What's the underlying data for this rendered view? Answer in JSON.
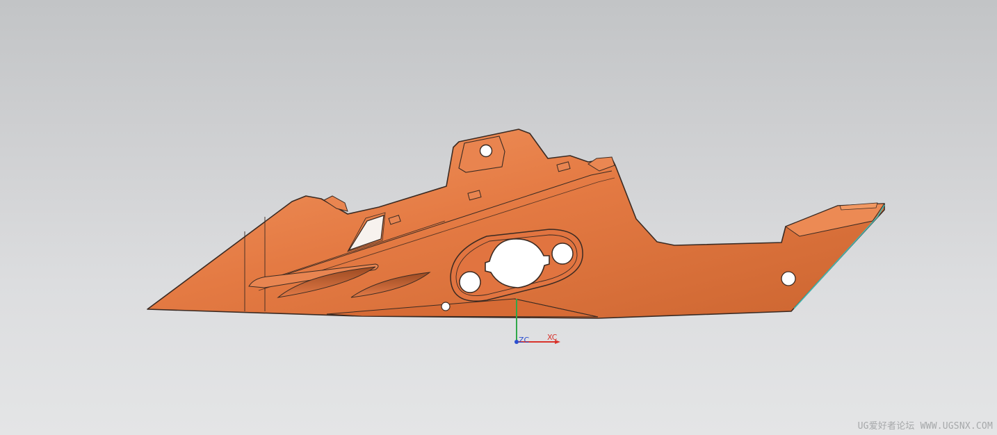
{
  "viewport": {
    "background_top": "#c2c4c6",
    "background_bottom": "#e4e5e6"
  },
  "model": {
    "part_color": "#e47a43",
    "part_highlight": "#f0935c",
    "part_shadow": "#c9622e",
    "edge_color": "#3a2a22",
    "hole_color": "#ffffff",
    "accent_edge_color": "#3fb6b0"
  },
  "triad": {
    "x_label": "XC",
    "z_label": "ZC",
    "x_color": "#d8332c",
    "y_color": "#2fa84a",
    "z_color": "#2b4fd0"
  },
  "watermark": {
    "text": "UG爱好者论坛 WWW.UGSNX.COM"
  }
}
